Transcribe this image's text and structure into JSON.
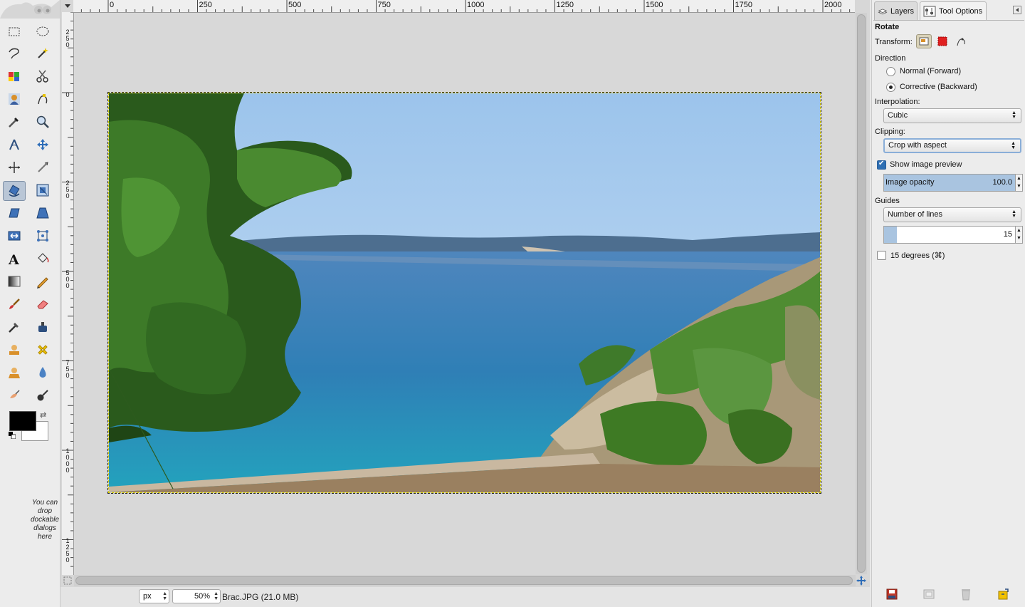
{
  "toolbox": {
    "drop_hint": "You can drop dockable dialogs here",
    "fg_color": "#000000",
    "bg_color": "#ffffff"
  },
  "ruler": {
    "h_labels": [
      "0",
      "250",
      "500",
      "750",
      "1000",
      "1250",
      "1500",
      "1750",
      "2000"
    ],
    "v_labels": [
      "250",
      "0",
      "250",
      "500",
      "750",
      "1000",
      "1250"
    ]
  },
  "image": {
    "name": "Brac.JPG (21.0 MB)",
    "unit": "px",
    "zoom": "50",
    "zoom_unit": "%"
  },
  "dock": {
    "tabs": [
      {
        "label": "Layers",
        "icon": "layers-icon",
        "active": false
      },
      {
        "label": "Tool Options",
        "icon": "tool-options-icon",
        "active": true
      }
    ],
    "tool_options": {
      "title": "Rotate",
      "transform_label": "Transform:",
      "transform_modes": [
        "layer",
        "selection",
        "path"
      ],
      "transform_active": "layer",
      "direction_label": "Direction",
      "direction_options": [
        "Normal (Forward)",
        "Corrective (Backward)"
      ],
      "direction_selected": "Corrective (Backward)",
      "interpolation_label": "Interpolation:",
      "interpolation_value": "Cubic",
      "clipping_label": "Clipping:",
      "clipping_value": "Crop with aspect",
      "show_preview_label": "Show image preview",
      "show_preview_checked": true,
      "opacity_label": "Image opacity",
      "opacity_value": "100.0",
      "opacity_fraction": 1.0,
      "guides_label": "Guides",
      "guides_value": "Number of lines",
      "lines_value": "15",
      "lines_fraction": 0.1,
      "degrees_label": "15 degrees  (⌘)",
      "degrees_checked": false
    },
    "bottom_buttons": [
      "save-options-icon",
      "restore-options-icon",
      "delete-options-icon",
      "reset-options-icon"
    ]
  },
  "colors": {
    "accent": "#2f6fb3",
    "selection_fill": "#a9c4e0",
    "canvas_bg": "#d8d8d8"
  }
}
